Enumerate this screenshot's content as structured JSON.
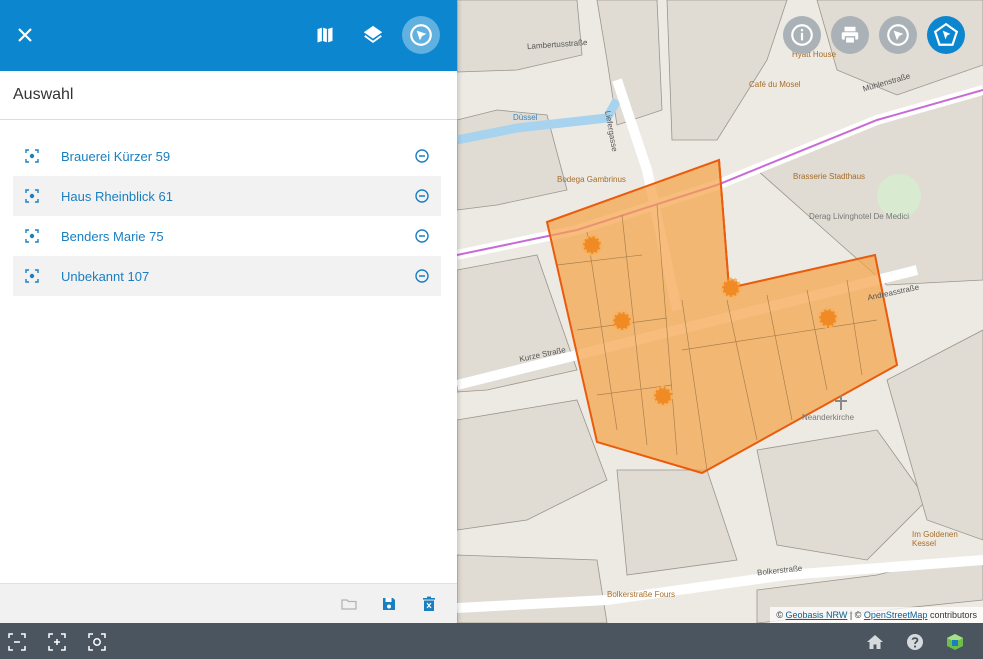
{
  "header": {
    "close_icon": "close-icon",
    "map_icon": "map-icon",
    "layers_icon": "layers-icon",
    "select_icon": "select-cursor-icon"
  },
  "panel": {
    "title": "Auswahl",
    "items": [
      {
        "label": "Brauerei Kürzer 59"
      },
      {
        "label": "Haus Rheinblick 61"
      },
      {
        "label": "Benders Marie 75"
      },
      {
        "label": "Unbekannt 107"
      }
    ]
  },
  "map": {
    "streets": [
      "Lambertusstraße",
      "Liefergasse",
      "Mühlenstraße",
      "Kurze Straße",
      "Andreasstraße",
      "Bolkerstraße",
      "Düssel"
    ],
    "pois": [
      "Hyatt House",
      "Café du Mosel",
      "Bodega Gambrinus",
      "Brasserie Stadthaus",
      "Derag Livinghotel De Medici",
      "Neanderkirche",
      "Im Goldenen Kessel",
      "Bolkerstraße Fours"
    ],
    "selection_color": "#f5a34a"
  },
  "map_controls": {
    "info_icon": "info-icon",
    "print_icon": "print-icon",
    "select_icon": "select-cursor-icon",
    "polygon_icon": "polygon-select-icon"
  },
  "attribution": {
    "prefix": "©",
    "geobasis": "Geobasis NRW",
    "separator": "| ©",
    "osm": "OpenStreetMap",
    "suffix": "contributors"
  },
  "footer": {
    "open_icon": "folder-icon",
    "save_icon": "save-icon",
    "delete_icon": "delete-icon"
  },
  "statusbar": {
    "left_icons": [
      "zoom-extent-icon",
      "zoom-selection-icon",
      "zoom-item-icon"
    ],
    "right_icons": [
      "home-icon",
      "help-icon",
      "app-logo-icon"
    ]
  },
  "colors": {
    "primary": "#0b86cf",
    "statusbar": "#4a5560",
    "link": "#1a7fc1"
  }
}
